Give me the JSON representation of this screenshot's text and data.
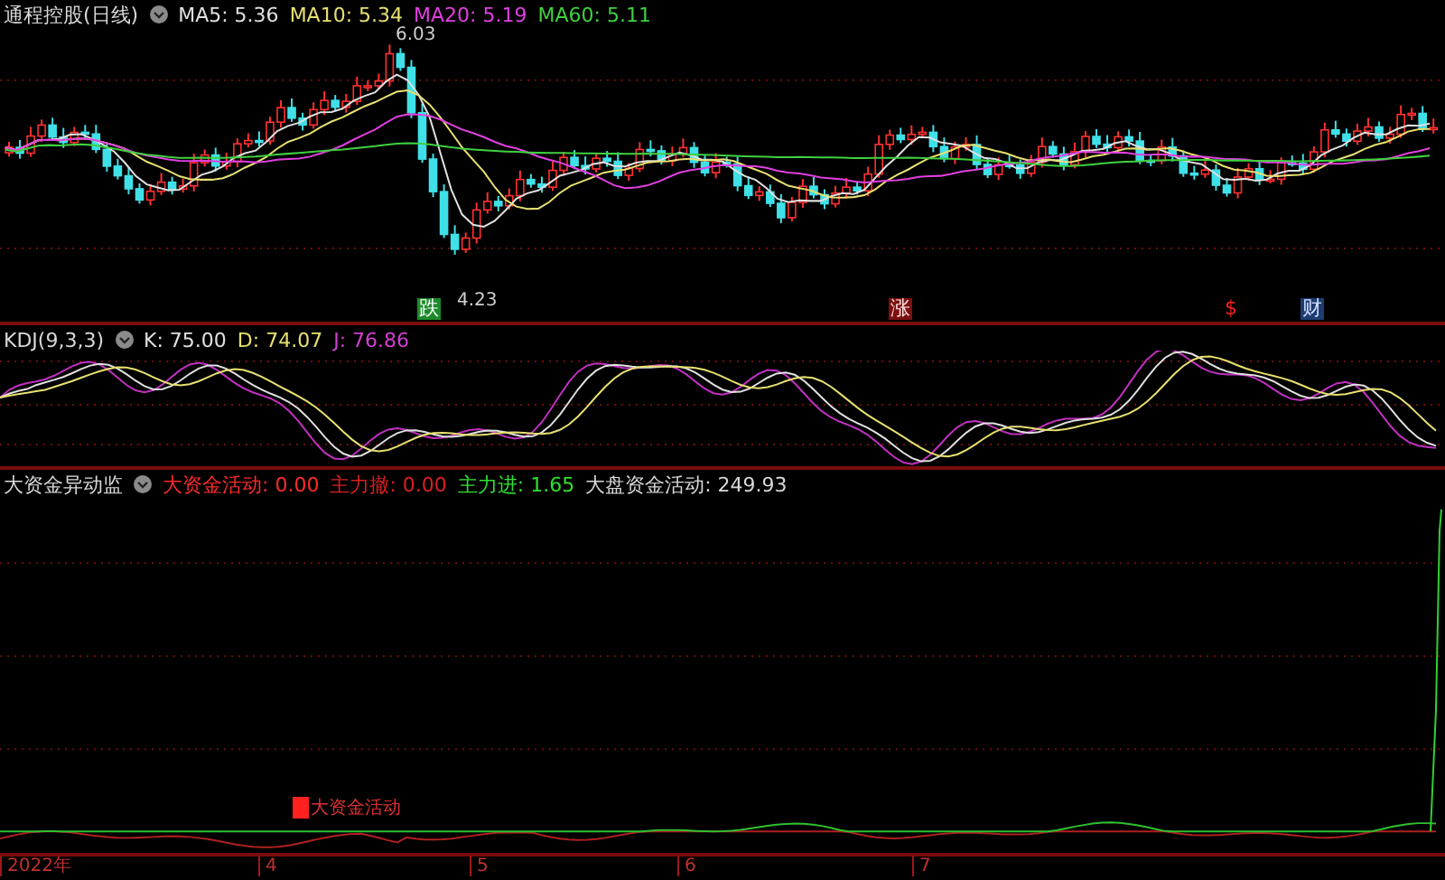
{
  "main_panel": {
    "title": "通程控股(日线)",
    "indicators": [
      {
        "label": "MA5: 5.36",
        "color": "#e0e0e0"
      },
      {
        "label": "MA10: 5.34",
        "color": "#e8e070"
      },
      {
        "label": "MA20: 5.19",
        "color": "#e040e0"
      },
      {
        "label": "MA60: 5.11",
        "color": "#40d040"
      }
    ],
    "high_label": "6.03",
    "low_label": "4.23",
    "signals": [
      {
        "text": "跌",
        "kind": "down"
      },
      {
        "text": "涨",
        "kind": "up"
      },
      {
        "text": "$",
        "kind": "cash"
      },
      {
        "text": "财",
        "kind": "wealth"
      }
    ]
  },
  "kdj_panel": {
    "title": "KDJ(9,3,3)",
    "indicators": [
      {
        "label": "K: 75.00",
        "color": "#e0e0e0"
      },
      {
        "label": "D: 74.07",
        "color": "#e8e070"
      },
      {
        "label": "J: 76.86",
        "color": "#d040d0"
      }
    ]
  },
  "fund_panel": {
    "title": "大资金异动监",
    "indicators": [
      {
        "label": "大资金活动: 0.00",
        "color": "#ff2a2a"
      },
      {
        "label": "主力撤: 0.00",
        "color": "#d82020"
      },
      {
        "label": "主力进: 1.65",
        "color": "#30e030"
      },
      {
        "label": "大盘资金活动: 249.93",
        "color": "#d8d8d8"
      }
    ],
    "marker_label": "大资金活动"
  },
  "time_axis": {
    "labels": [
      "2022年",
      "4",
      "5",
      "6",
      "7"
    ]
  }
}
